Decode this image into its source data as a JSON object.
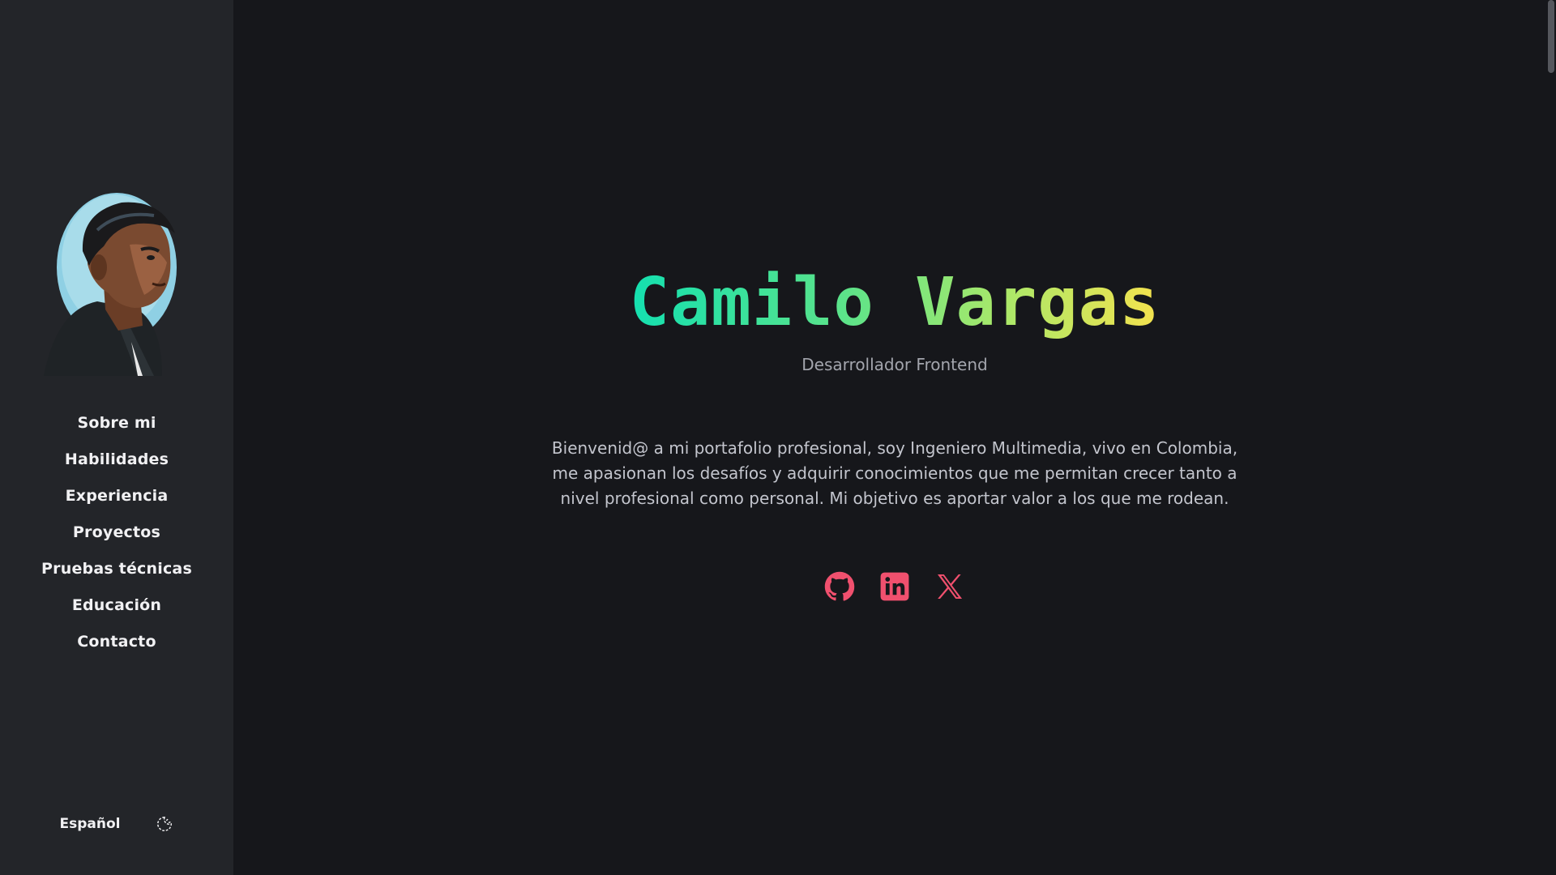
{
  "sidebar": {
    "nav_items": [
      {
        "label": "Sobre mi"
      },
      {
        "label": "Habilidades"
      },
      {
        "label": "Experiencia"
      },
      {
        "label": "Proyectos"
      },
      {
        "label": "Pruebas técnicas"
      },
      {
        "label": "Educación"
      },
      {
        "label": "Contacto"
      }
    ],
    "language_label": "Español",
    "theme_icon": "moon-icon"
  },
  "hero": {
    "name": "Camilo Vargas",
    "subtitle": "Desarrollador Frontend",
    "intro": "Bienvenid@ a mi portafolio profesional, soy Ingeniero Multimedia, vivo en Colombia, me apasionan los desafíos y adquirir conocimientos que me permitan crecer tanto a nivel profesional como personal. Mi objetivo es aportar valor a los que me rodean."
  },
  "social": [
    {
      "icon": "github-icon"
    },
    {
      "icon": "linkedin-icon"
    },
    {
      "icon": "x-icon"
    }
  ],
  "colors": {
    "accent_social": "#f0506e",
    "gradient_start": "#14e0b0",
    "gradient_end": "#f4e24e",
    "sidebar_bg": "#232529",
    "main_bg": "#16171b"
  }
}
